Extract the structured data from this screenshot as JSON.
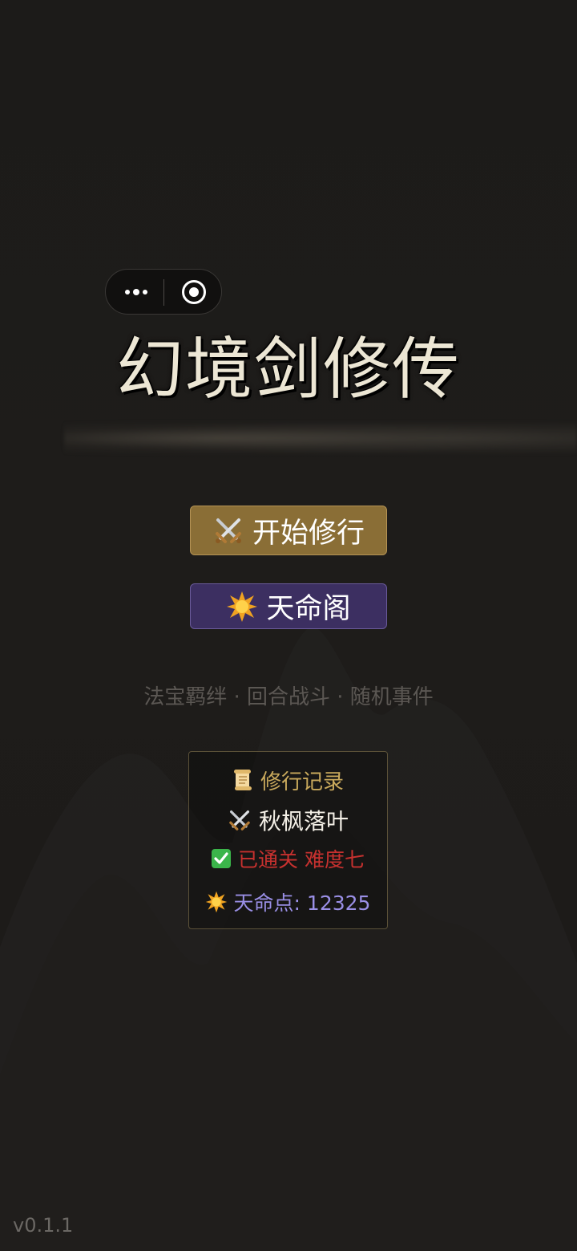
{
  "capsule": {
    "more_icon": "more-dots-icon",
    "close_icon": "target-circle-icon"
  },
  "title": "幻境剑修传",
  "buttons": {
    "start_label": "开始修行",
    "start_icon": "crossed-swords-icon",
    "fate_label": "天命阁",
    "fate_icon": "starburst-icon"
  },
  "features": "法宝羁绊 · 回合战斗 · 随机事件",
  "record": {
    "title": "修行记录",
    "title_icon": "scroll-icon",
    "character": "秋枫落叶",
    "character_icon": "crossed-swords-icon",
    "status": "已通关 难度七",
    "status_icon": "check-box-icon",
    "points": "天命点: 12325",
    "points_icon": "starburst-icon"
  },
  "version": "v0.1.1",
  "colors": {
    "background": "#1d1b19",
    "title_text": "#ece6d4",
    "start_button": "#8a6e36",
    "fate_button": "#3c2f61",
    "record_title": "#c9a95c",
    "status_red": "#c7312f",
    "points_purple": "#9a8fe6"
  }
}
